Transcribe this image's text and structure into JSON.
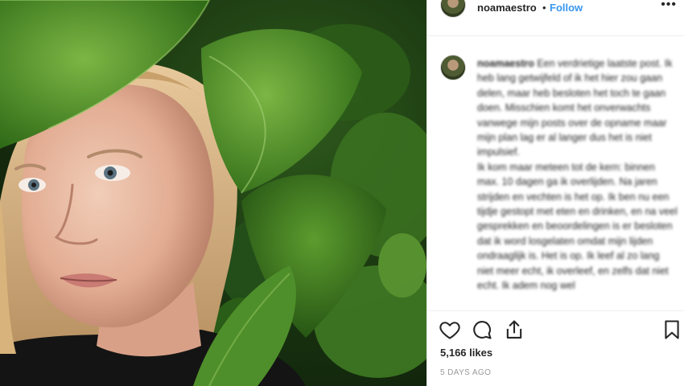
{
  "post": {
    "username": "noamaestro",
    "separator": "•",
    "follow_label": "Follow",
    "more_label": "•••",
    "caption_user": "noamaestro",
    "caption_paragraphs": [
      "Een verdrietige laatste post. Ik heb lang getwijfeld of ik het hier zou gaan delen, maar heb besloten het toch te gaan doen. Misschien komt het onverwachts vanwege mijn posts over de opname maar mijn plan lag er al langer dus het is niet impulsief.",
      "Ik kom maar meteen tot de kern: binnen max. 10 dagen ga ik overlijden. Na jaren strijden en vechten is het op. Ik ben nu een tijdje gestopt met eten en drinken, en na veel gesprekken en beoordelingen is er besloten dat ik word losgelaten omdat mijn lijden ondraaglijk is. Het is op. Ik leef al zo lang niet meer echt, ik overleef, en zelfs dat niet echt. Ik adem nog wel"
    ],
    "likes": "5,166 likes",
    "time": "5 DAYS AGO"
  },
  "icons": {
    "like": "heart-icon",
    "comment": "comment-icon",
    "share": "share-icon",
    "save": "bookmark-icon"
  },
  "colors": {
    "follow": "#3897f0",
    "text": "#262626",
    "muted": "#999999",
    "border": "#efefef"
  }
}
